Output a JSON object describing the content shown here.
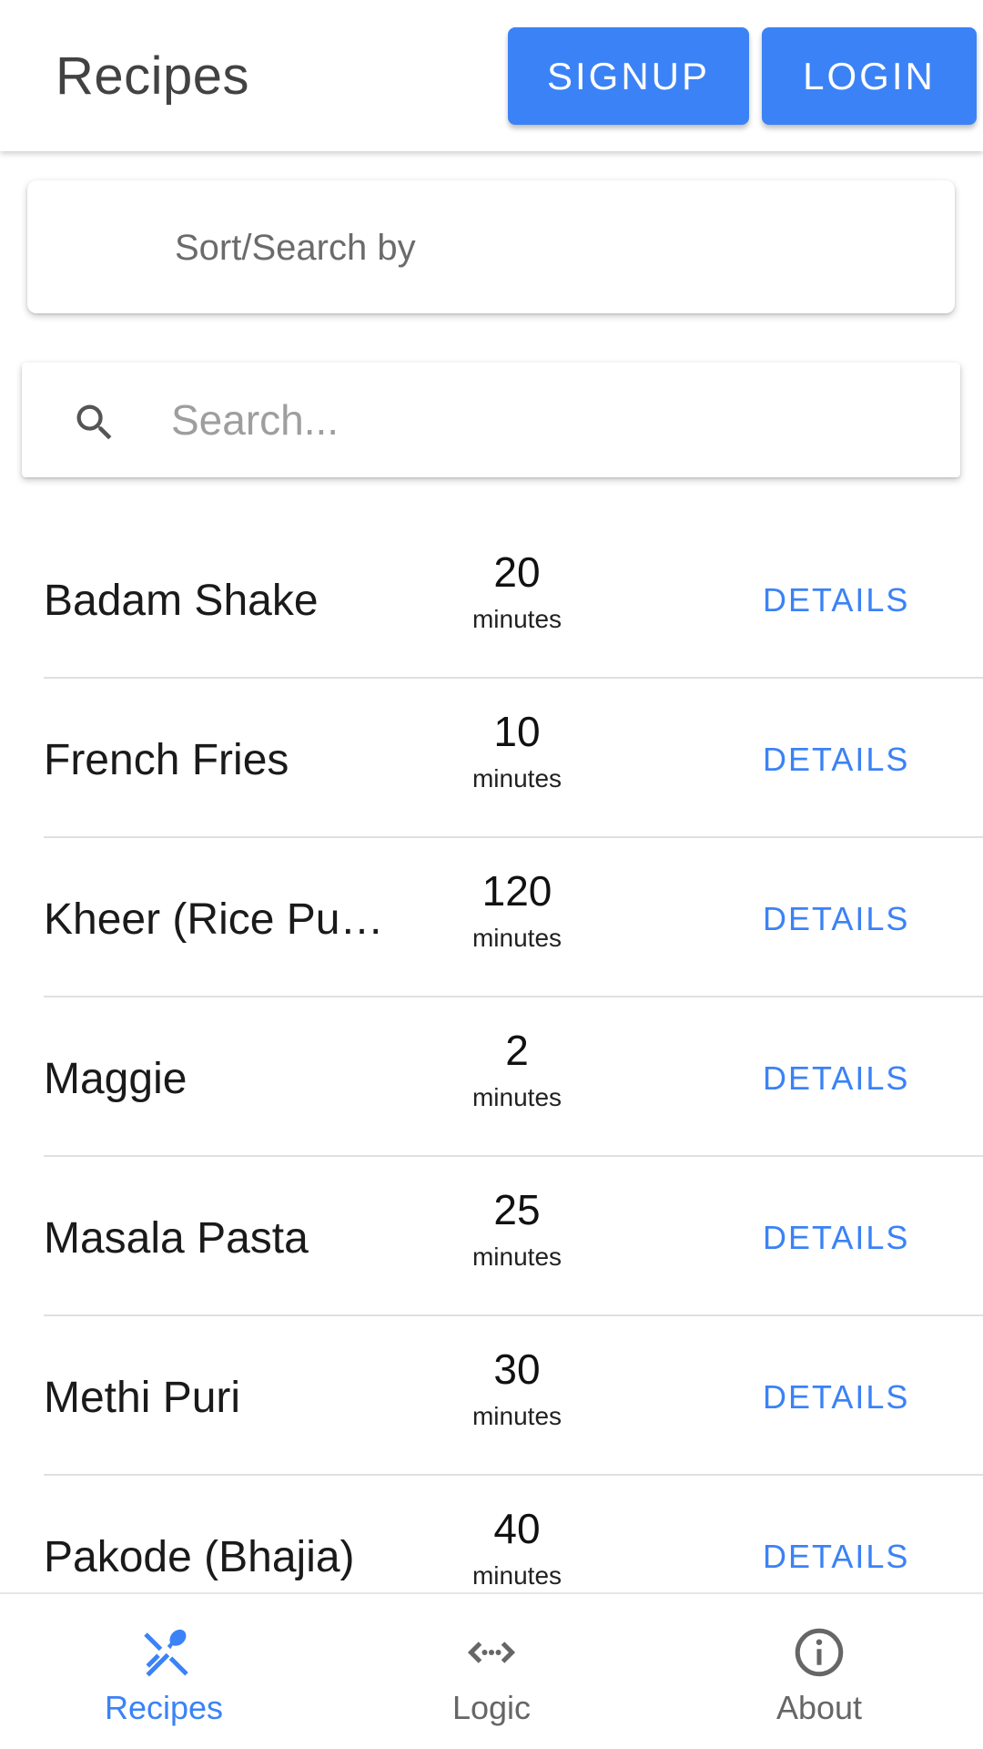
{
  "header": {
    "title": "Recipes",
    "signup_label": "SIGNUP",
    "login_label": "LOGIN"
  },
  "sort": {
    "label": "Sort/Search by",
    "icon": "gear-icon"
  },
  "search": {
    "placeholder": "Search...",
    "value": "",
    "icon": "search-icon"
  },
  "recipes": [
    {
      "name": "Badam Shake",
      "time": "20",
      "unit": "minutes",
      "action": "DETAILS"
    },
    {
      "name": "French Fries",
      "time": "10",
      "unit": "minutes",
      "action": "DETAILS"
    },
    {
      "name": "Kheer (Rice Pu…",
      "time": "120",
      "unit": "minutes",
      "action": "DETAILS"
    },
    {
      "name": "Maggie",
      "time": "2",
      "unit": "minutes",
      "action": "DETAILS"
    },
    {
      "name": "Masala Pasta",
      "time": "25",
      "unit": "minutes",
      "action": "DETAILS"
    },
    {
      "name": "Methi Puri",
      "time": "30",
      "unit": "minutes",
      "action": "DETAILS"
    },
    {
      "name": "Pakode (Bhajia)",
      "time": "40",
      "unit": "minutes",
      "action": "DETAILS"
    }
  ],
  "bottom_nav": {
    "items": [
      {
        "label": "Recipes",
        "icon": "utensils-icon",
        "active": true
      },
      {
        "label": "Logic",
        "icon": "code-arrows-icon",
        "active": false
      },
      {
        "label": "About",
        "icon": "info-icon",
        "active": false
      }
    ]
  },
  "colors": {
    "accent": "#3b82f6",
    "title_text": "#424242",
    "inactive_nav": "#666666"
  }
}
